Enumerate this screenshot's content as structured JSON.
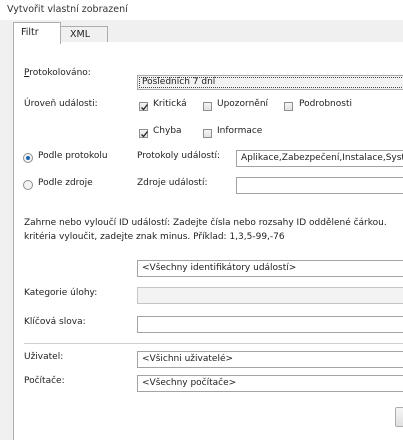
{
  "window": {
    "title": "Vytvořit vlastní zobrazení"
  },
  "tabs": [
    {
      "label": "Filtr",
      "active": true
    },
    {
      "label": "XML",
      "active": false
    }
  ],
  "filter": {
    "logged": {
      "label": "Protokolováno:",
      "value": "Posledních 7 dní"
    },
    "event_level": {
      "label": "Úroveň události:",
      "options": [
        {
          "label": "Kritická",
          "checked": true
        },
        {
          "label": "Upozornění",
          "checked": false
        },
        {
          "label": "Podrobnosti",
          "checked": false
        },
        {
          "label": "Chyba",
          "checked": true
        },
        {
          "label": "Informace",
          "checked": false
        }
      ]
    },
    "by_log": {
      "label": "Podle protokolu",
      "selected": true,
      "field_label": "Protokoly událostí:",
      "value": "Aplikace,Zabezpečení,Instalace,Systém"
    },
    "by_source": {
      "label": "Podle zdroje",
      "selected": false,
      "field_label": "Zdroje událostí:",
      "value": ""
    },
    "description_line1": "Zahrne nebo vyloučí ID událostí: Zadejte čísla nebo rozsahy ID oddělené čárkou.",
    "description_line2": "kritéria vyloučit, zadejte znak minus. Příklad: 1,3,5-99,-76",
    "event_ids": {
      "value": "<Všechny identifikátory událostí>"
    },
    "task_category": {
      "label": "Kategorie úlohy:",
      "value": ""
    },
    "keywords": {
      "label": "Klíčová slova:",
      "value": ""
    },
    "user": {
      "label": "Uživatel:",
      "value": "<Všichni uživatelé>"
    },
    "computer": {
      "label": "Počítače:",
      "value": "<Všechny počítače>"
    }
  }
}
